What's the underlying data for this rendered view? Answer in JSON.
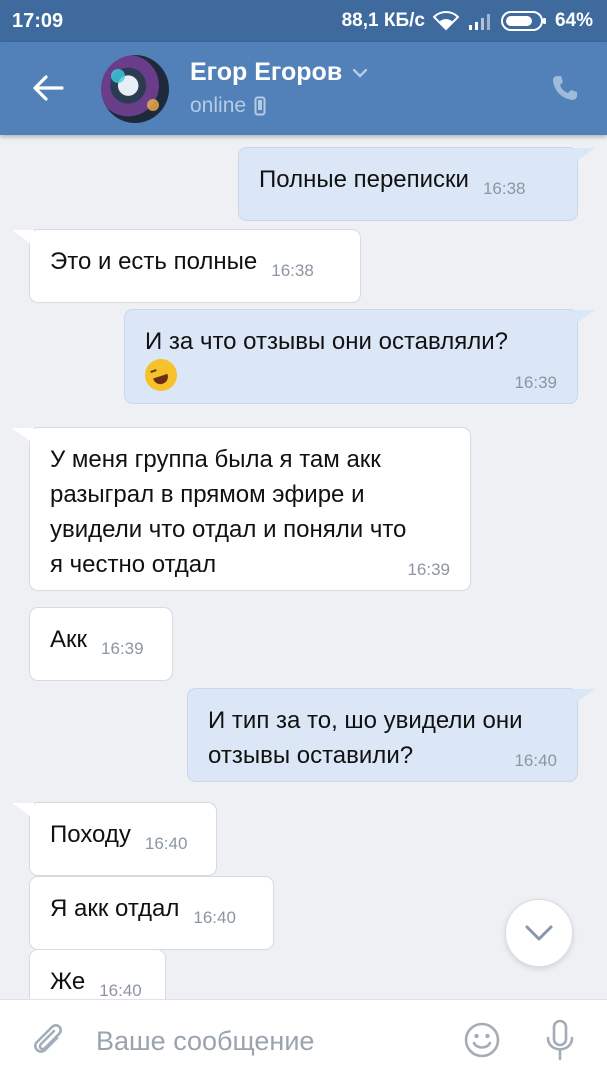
{
  "status_bar": {
    "time": "17:09",
    "speed": "88,1 КБ/с",
    "battery": "64%",
    "icons": [
      "wifi-icon",
      "signal-icon",
      "battery-icon"
    ]
  },
  "header": {
    "contact_name": "Егор Егоров",
    "status": "online",
    "icons": [
      "back-arrow-icon",
      "chevron-down-icon",
      "mobile-phone-icon",
      "phone-icon"
    ]
  },
  "messages": [
    {
      "direction": "out",
      "text": "Полные переписки",
      "time": "16:38"
    },
    {
      "direction": "in",
      "text": "Это и есть полные",
      "time": "16:38"
    },
    {
      "direction": "out",
      "text": "И за что отзывы они оставляли?",
      "emoji": "rofl-emoji",
      "time": "16:39"
    },
    {
      "direction": "in",
      "text": "У меня группа была я там акк\nразыграл в прямом эфире и\nувидели что отдал и поняли что\nя честно отдал",
      "time": "16:39"
    },
    {
      "direction": "in",
      "text": "Акк",
      "time": "16:39"
    },
    {
      "direction": "out",
      "text": "И тип за то, шо увидели они\nотзывы оставили?",
      "time": "16:40"
    },
    {
      "direction": "in",
      "text": "Походу",
      "time": "16:40"
    },
    {
      "direction": "in",
      "text": "Я акк отдал",
      "time": "16:40"
    },
    {
      "direction": "in",
      "text": "Же",
      "time": "16:40"
    }
  ],
  "composer": {
    "placeholder": "Ваше сообщение",
    "icons": [
      "paperclip-icon",
      "smiley-icon",
      "microphone-icon"
    ]
  },
  "colors": {
    "status_bar": "#3f6a9e",
    "header": "#5181b8",
    "chat_background": "#eef0f3",
    "outgoing_bubble": "#dbe7f6",
    "incoming_bubble": "#ffffff"
  }
}
